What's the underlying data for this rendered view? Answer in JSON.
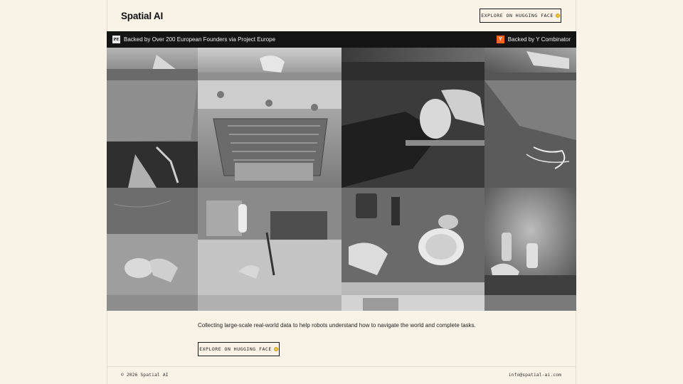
{
  "header": {
    "logo": "Spatial AI",
    "cta_label": "EXPLORE ON HUGGING FACE"
  },
  "banner": {
    "left_badge": "PE",
    "left_text": "Backed by Over 200 European Founders via Project Europe",
    "right_badge": "Y",
    "right_text": "Backed by Y Combinator"
  },
  "grid": {
    "tiles": [
      {
        "scene": "hand-on-counter"
      },
      {
        "scene": "hand-reaching-sink"
      },
      {
        "scene": "dark-kitchen-top"
      },
      {
        "scene": "hand-on-shelf"
      },
      {
        "scene": "wooden-cabinet-drawer"
      },
      {
        "scene": "open-oven-rack"
      },
      {
        "scene": "hand-holding-jar"
      },
      {
        "scene": "table-with-cables"
      },
      {
        "scene": "marble-counter-hands"
      },
      {
        "scene": "kitchen-paper-towel-microwave"
      },
      {
        "scene": "hands-with-dishes"
      },
      {
        "scene": "hand-with-bottles"
      }
    ]
  },
  "main": {
    "tagline": "Collecting large-scale real-world data to help robots understand how to navigate the world and complete tasks.",
    "cta_label": "EXPLORE ON HUGGING FACE"
  },
  "footer": {
    "copyright": "© 2026 Spatial AI",
    "email": "info@spatial-ai.com"
  },
  "colors": {
    "background": "#f9f2e6",
    "banner": "#141414",
    "yc_orange": "#f26522"
  }
}
